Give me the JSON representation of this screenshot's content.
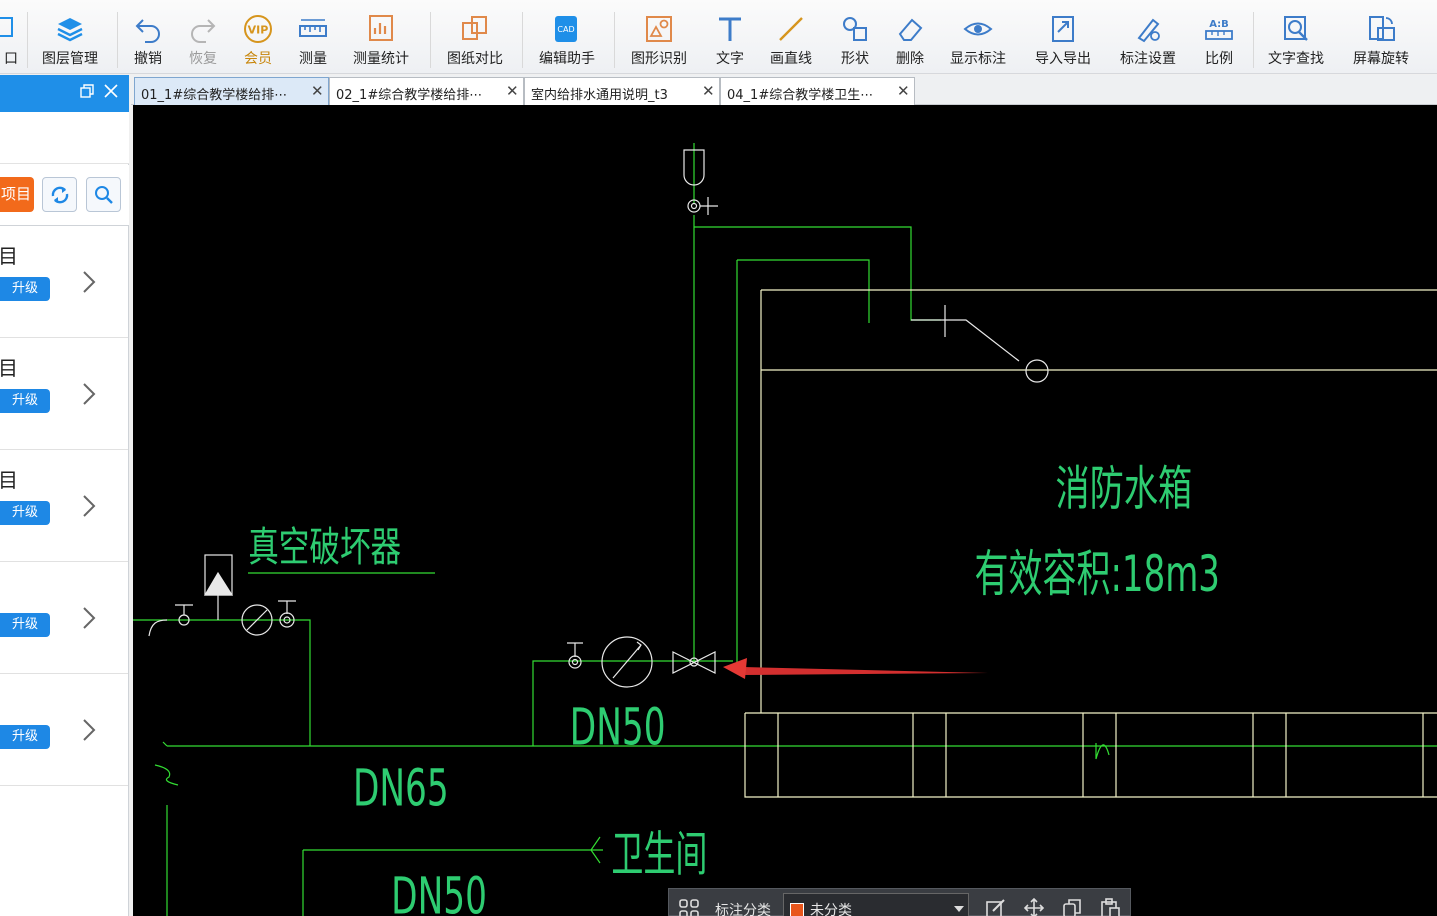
{
  "toolbar": {
    "partial_left_label": "口",
    "layers": "图层管理",
    "undo": "撤销",
    "redo": "恢复",
    "vip": "会员",
    "measure": "测量",
    "measure_stats": "测量统计",
    "compare": "图纸对比",
    "edit_helper": "编辑助手",
    "shape_recognition": "图形识别",
    "text": "文字",
    "draw_line": "画直线",
    "shape": "形状",
    "delete": "删除",
    "show_annotation": "显示标注",
    "import_export": "导入导出",
    "annotation_settings": "标注设置",
    "scale": "比例",
    "text_search": "文字查找",
    "screen_rotate": "屏幕旋转"
  },
  "left_panel": {
    "project_button": "项目",
    "items": [
      {
        "title": "目",
        "badge": "升级"
      },
      {
        "title": "目",
        "badge": "升级"
      },
      {
        "title": "目",
        "badge": "升级"
      },
      {
        "title": "",
        "badge": "升级"
      },
      {
        "title": "",
        "badge": "升级"
      }
    ]
  },
  "tabs": [
    {
      "label": "01_1#综合教学楼给排⋯",
      "active": true
    },
    {
      "label": "02_1#综合教学楼给排⋯",
      "active": false
    },
    {
      "label": "室内给排水通用说明_t3",
      "active": false
    },
    {
      "label": "04_1#综合教学楼卫生⋯",
      "active": false
    }
  ],
  "drawing": {
    "vacuum_breaker_label": "真空破坏器",
    "fire_tank_label": "消防水箱",
    "capacity_label": "有效容积:18m3",
    "dn50_upper": "DN50",
    "dn65": "DN65",
    "dn50_lower": "DN50",
    "restroom_label": "卫生间",
    "colors": {
      "pipe": "#33dd33",
      "tank": "#f2f2c8",
      "text": "#2ecc71",
      "white_line": "#e8e8e8",
      "arrow": "#e53935"
    }
  },
  "floatbar": {
    "category_label": "标注分类",
    "category_value": "未分类"
  }
}
